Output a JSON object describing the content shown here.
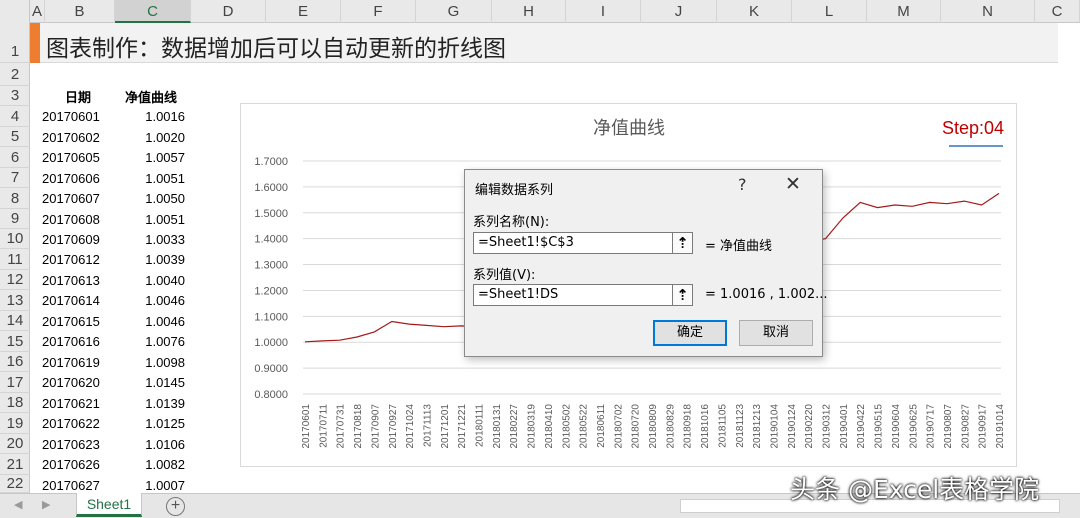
{
  "columns": [
    "A",
    "B",
    "C",
    "D",
    "E",
    "F",
    "G",
    "H",
    "I",
    "J",
    "K",
    "L",
    "M",
    "N",
    "C"
  ],
  "rows": [
    "1",
    "2",
    "3",
    "4",
    "5",
    "6",
    "7",
    "8",
    "9",
    "10",
    "11",
    "12",
    "13",
    "14",
    "15",
    "16",
    "17",
    "18",
    "19",
    "20",
    "21",
    "22"
  ],
  "sheet_title": "图表制作：数据增加后可以自动更新的折线图",
  "table": {
    "headers": [
      "日期",
      "净值曲线"
    ],
    "rows": [
      [
        "20170601",
        "1.0016"
      ],
      [
        "20170602",
        "1.0020"
      ],
      [
        "20170605",
        "1.0057"
      ],
      [
        "20170606",
        "1.0051"
      ],
      [
        "20170607",
        "1.0050"
      ],
      [
        "20170608",
        "1.0051"
      ],
      [
        "20170609",
        "1.0033"
      ],
      [
        "20170612",
        "1.0039"
      ],
      [
        "20170613",
        "1.0040"
      ],
      [
        "20170614",
        "1.0046"
      ],
      [
        "20170615",
        "1.0046"
      ],
      [
        "20170616",
        "1.0076"
      ],
      [
        "20170619",
        "1.0098"
      ],
      [
        "20170620",
        "1.0145"
      ],
      [
        "20170621",
        "1.0139"
      ],
      [
        "20170622",
        "1.0125"
      ],
      [
        "20170623",
        "1.0106"
      ],
      [
        "20170626",
        "1.0082"
      ],
      [
        "20170627",
        "1.0007"
      ]
    ]
  },
  "chart": {
    "title": "净值曲线",
    "step": "Step:04",
    "step_color": "#c00000",
    "line_color": "#a31a1a",
    "y_ticks": [
      "1.7000",
      "1.6000",
      "1.5000",
      "1.4000",
      "1.3000",
      "1.2000",
      "1.1000",
      "1.0000",
      "0.9000",
      "0.8000"
    ],
    "x_ticks": [
      "20170601",
      "20170711",
      "20170731",
      "20170818",
      "20170907",
      "20170927",
      "20171024",
      "20171113",
      "20171201",
      "20171221",
      "20180111",
      "20180131",
      "20180227",
      "20180319",
      "20180410",
      "20180502",
      "20180522",
      "20180611",
      "20180702",
      "20180720",
      "20180809",
      "20180829",
      "20180918",
      "20181016",
      "20181105",
      "20181123",
      "20181213",
      "20190104",
      "20190124",
      "20190220",
      "20190312",
      "20190401",
      "20190422",
      "20190515",
      "20190604",
      "20190625",
      "20190717",
      "20190807",
      "20190827",
      "20190917",
      "20191014"
    ],
    "series_values": [
      1.0016,
      1.005,
      1.008,
      1.02,
      1.04,
      1.08,
      1.07,
      1.065,
      1.06,
      1.063,
      1.058,
      1.062,
      1.06,
      1.065,
      1.07,
      1.075,
      1.078,
      1.08,
      1.085,
      1.09,
      1.1,
      1.12,
      1.15,
      1.2,
      1.25,
      1.3,
      1.33,
      1.36,
      1.38,
      1.39,
      1.4,
      1.48,
      1.54,
      1.52,
      1.53,
      1.525,
      1.54,
      1.535,
      1.545,
      1.53,
      1.575
    ],
    "y_range": [
      0.8,
      1.7
    ]
  },
  "dialog": {
    "title": "编辑数据系列",
    "help": "?",
    "close": "✕",
    "name_label": "系列名称(N):",
    "name_value": "=Sheet1!$C$3",
    "name_preview": "= 净值曲线",
    "values_label": "系列值(V):",
    "values_value": "=Sheet1!DS",
    "values_preview": "= 1.0016 , 1.002...",
    "ref_icon": "⇡",
    "ok": "确定",
    "cancel": "取消"
  },
  "sheet_tab": "Sheet1",
  "add_sheet": "+",
  "watermark": "头条 @Excel表格学院"
}
